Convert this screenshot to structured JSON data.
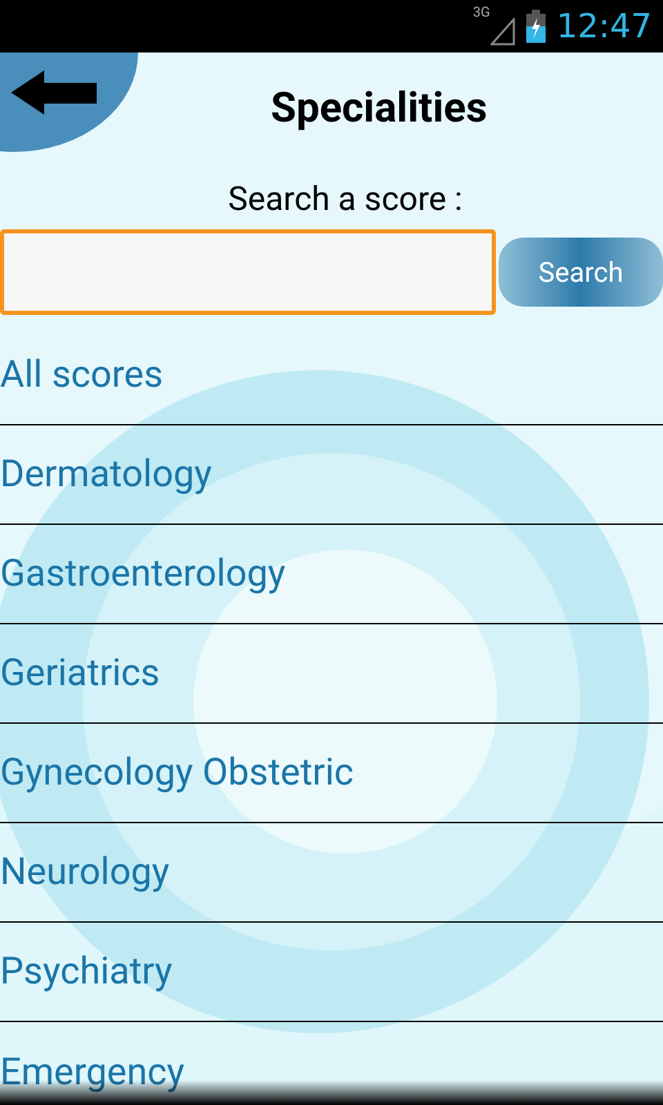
{
  "status_bar": {
    "network": "3G",
    "time": "12:47"
  },
  "header": {
    "title": "Specialities"
  },
  "search": {
    "label": "Search a score :",
    "button": "Search"
  },
  "specialities": [
    {
      "label": "All scores"
    },
    {
      "label": "Dermatology"
    },
    {
      "label": "Gastroenterology"
    },
    {
      "label": "Geriatrics"
    },
    {
      "label": "Gynecology Obstetric"
    },
    {
      "label": "Neurology"
    },
    {
      "label": "Psychiatry"
    },
    {
      "label": "Emergency"
    }
  ]
}
